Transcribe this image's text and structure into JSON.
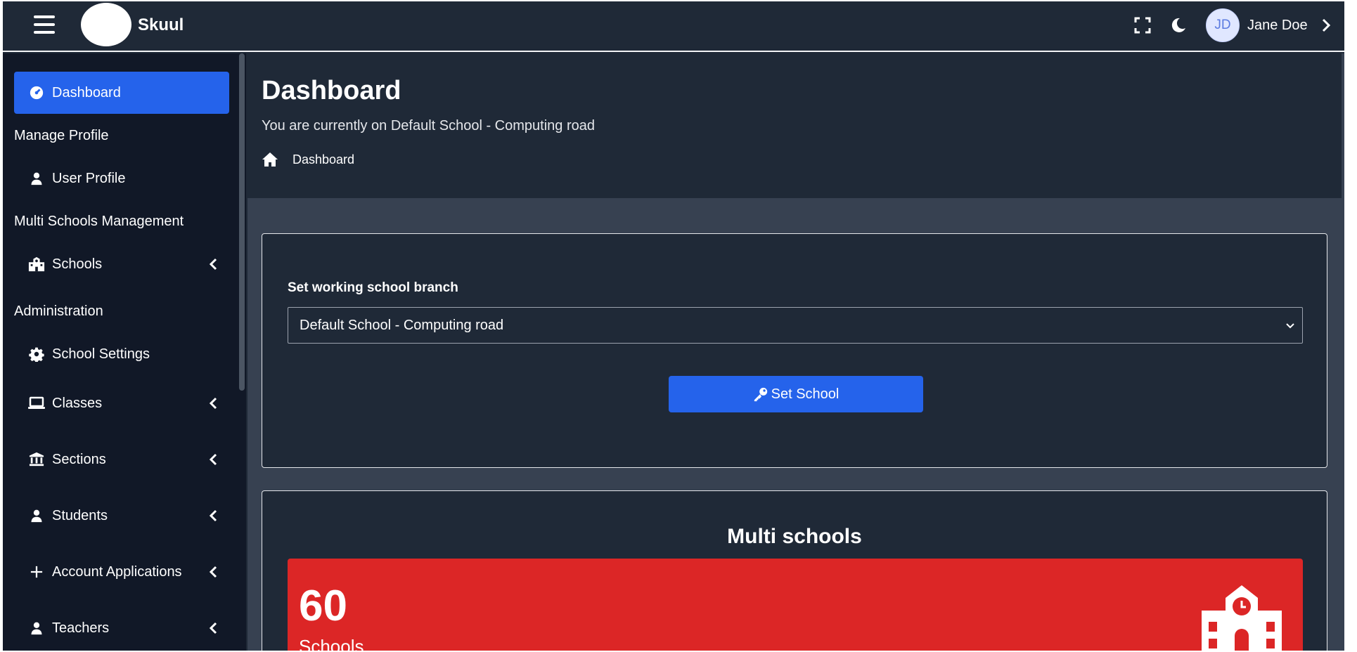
{
  "header": {
    "brand": "Skuul",
    "user_initials": "JD",
    "user_name": "Jane Doe"
  },
  "sidebar": {
    "items": [
      {
        "label": "Dashboard",
        "icon": "gauge-icon",
        "active": true
      },
      {
        "header": "Manage Profile"
      },
      {
        "label": "User Profile",
        "icon": "user-icon"
      },
      {
        "header": "Multi Schools Management"
      },
      {
        "label": "Schools",
        "icon": "school-icon",
        "expandable": true
      },
      {
        "header": "Administration"
      },
      {
        "label": "School Settings",
        "icon": "gear-icon"
      },
      {
        "label": "Classes",
        "icon": "laptop-icon",
        "expandable": true
      },
      {
        "label": "Sections",
        "icon": "building-columns-icon",
        "expandable": true
      },
      {
        "label": "Students",
        "icon": "user-icon",
        "expandable": true
      },
      {
        "label": "Account Applications",
        "icon": "plus-icon",
        "expandable": true
      },
      {
        "label": "Teachers",
        "icon": "user-icon",
        "expandable": true
      }
    ]
  },
  "main": {
    "title": "Dashboard",
    "subtitle": "You are currently on Default School - Computing road",
    "breadcrumb": "Dashboard",
    "school_form": {
      "label": "Set working school branch",
      "selected": "Default School - Computing road",
      "button": "Set School"
    },
    "multi_schools": {
      "title": "Multi schools",
      "count": "60",
      "label": "Schools",
      "color": "#dc2626"
    }
  },
  "colors": {
    "accent": "#2563eb",
    "background": "#1f2937",
    "sidebar": "#111827"
  }
}
